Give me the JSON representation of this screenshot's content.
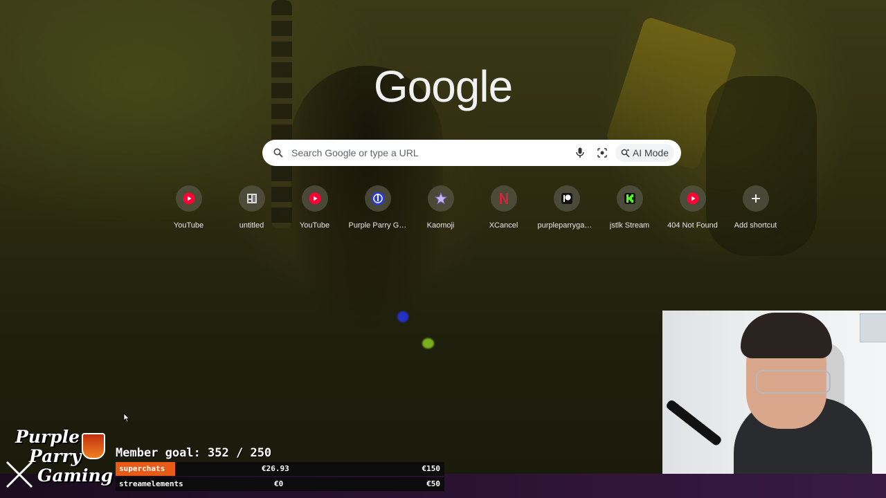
{
  "page": {
    "logo_text": "Google"
  },
  "search": {
    "placeholder": "Search Google or type a URL",
    "ai_mode_label": "AI Mode",
    "search_icon": "search-icon",
    "mic_icon": "microphone-icon",
    "lens_icon": "lens-icon"
  },
  "shortcuts": [
    {
      "label": "YouTube",
      "icon": "youtube-icon"
    },
    {
      "label": "untitled",
      "icon": "page-icon"
    },
    {
      "label": "YouTube",
      "icon": "youtube-icon"
    },
    {
      "label": "Purple Parry Ga...",
      "icon": "purple-parry-icon"
    },
    {
      "label": "Kaomoji",
      "icon": "star-icon"
    },
    {
      "label": "XCancel",
      "icon": "xcancel-icon"
    },
    {
      "label": "purpleparrygam...",
      "icon": "patreon-icon"
    },
    {
      "label": "jstlk Stream",
      "icon": "kick-icon"
    },
    {
      "label": "404 Not Found",
      "icon": "youtube-icon"
    },
    {
      "label": "Add shortcut",
      "icon": "plus-icon"
    }
  ],
  "overlay": {
    "brand_line1": "Purple",
    "brand_line2": "Parry",
    "brand_line3": "Gaming",
    "member_goal": "Member goal: 352 / 250",
    "rows": [
      {
        "name": "superchats",
        "current": "€26.93",
        "target": "€150",
        "progress": 0.18
      },
      {
        "name": "streamelements",
        "current": "€0",
        "target": "€50",
        "progress": 0
      }
    ]
  },
  "colors": {
    "youtube_red": "#ff0033",
    "progress_orange": "#e85a16",
    "kick_green": "#53fc18"
  }
}
